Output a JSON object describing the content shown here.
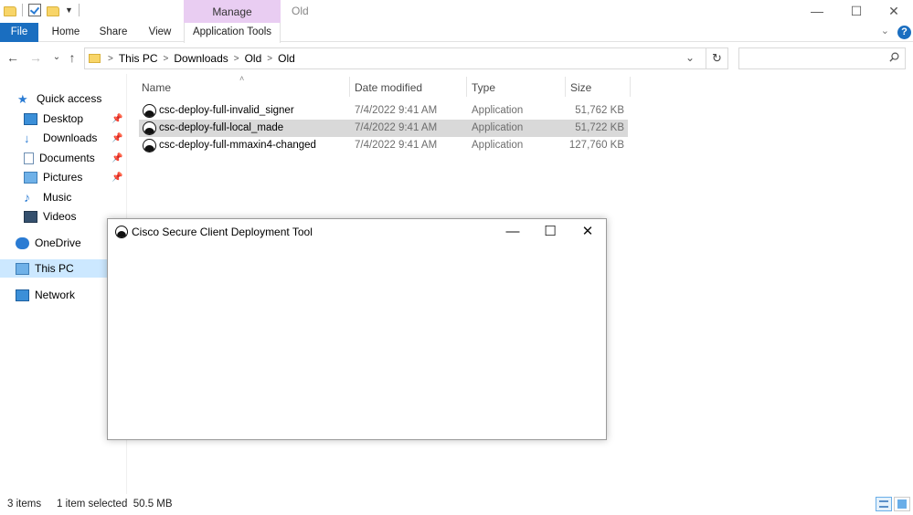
{
  "titlebar": {
    "manage_tab": "Manage",
    "folder_title": "Old",
    "minimize": "—",
    "maximize": "☐",
    "close": "✕"
  },
  "ribbon": {
    "tabs": [
      "File",
      "Home",
      "Share",
      "View",
      "Application Tools"
    ],
    "collapse": "⌄",
    "help": "?"
  },
  "address": {
    "crumbs": [
      "This PC",
      "Downloads",
      "Old",
      "Old"
    ],
    "separator": ">",
    "back": "←",
    "forward": "→",
    "recent": "⌄",
    "up": "↑",
    "dropdown": "⌄",
    "refresh": "↻",
    "search_value": ""
  },
  "navpane": {
    "items": [
      {
        "label": "Quick access",
        "icon": "star-icon"
      },
      {
        "label": "Desktop",
        "icon": "desktop-icon",
        "pinned": true
      },
      {
        "label": "Downloads",
        "icon": "download-icon",
        "pinned": true
      },
      {
        "label": "Documents",
        "icon": "documents-icon",
        "pinned": true
      },
      {
        "label": "Pictures",
        "icon": "pictures-icon",
        "pinned": true
      },
      {
        "label": "Music",
        "icon": "music-icon"
      },
      {
        "label": "Videos",
        "icon": "videos-icon"
      },
      {
        "label": "OneDrive",
        "icon": "onedrive-icon"
      },
      {
        "label": "This PC",
        "icon": "this-pc-icon",
        "selected": true
      },
      {
        "label": "Network",
        "icon": "network-icon"
      }
    ],
    "pin_glyph": "📌"
  },
  "filelist": {
    "columns": [
      "Name",
      "Date modified",
      "Type",
      "Size"
    ],
    "sort_glyph": "˄",
    "rows": [
      {
        "name": "csc-deploy-full-invalid_signer",
        "date": "7/4/2022 9:41 AM",
        "type": "Application",
        "size": "51,762 KB",
        "selected": false
      },
      {
        "name": "csc-deploy-full-local_made",
        "date": "7/4/2022 9:41 AM",
        "type": "Application",
        "size": "51,722 KB",
        "selected": true
      },
      {
        "name": "csc-deploy-full-mmaxin4-changed",
        "date": "7/4/2022 9:41 AM",
        "type": "Application",
        "size": "127,760 KB",
        "selected": false
      }
    ]
  },
  "dialog": {
    "title": "Cisco Secure Client Deployment Tool",
    "minimize": "—",
    "maximize": "☐",
    "close": "✕"
  },
  "statusbar": {
    "item_count": "3 items",
    "selection": "1 item selected  50.5 MB"
  },
  "colors": {
    "accent": "#1a6ec0",
    "manage_tab": "#e9cdf2",
    "selected_row": "#d9d9d9",
    "nav_selected": "#cce8ff"
  }
}
